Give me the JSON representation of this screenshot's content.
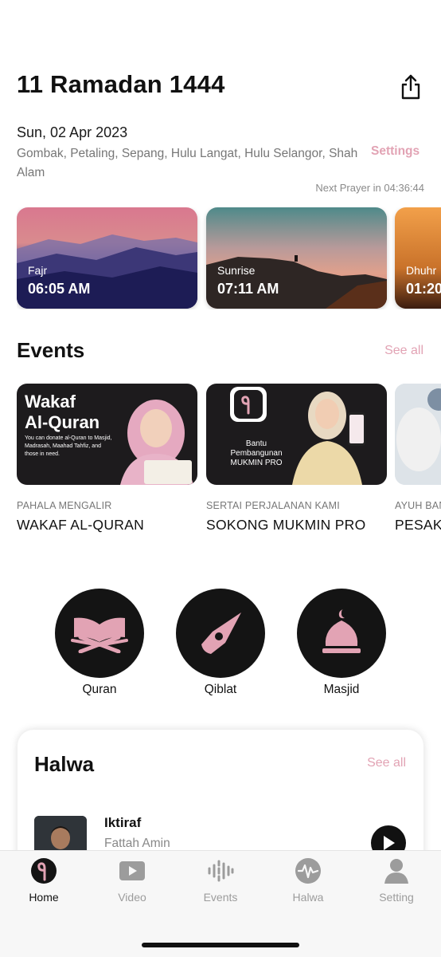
{
  "header": {
    "hijri_date": "11 Ramadan 1444",
    "share_icon": "share-icon",
    "gregorian_date": "Sun, 02 Apr 2023",
    "location": "Gombak, Petaling, Sepang, Hulu Langat, Hulu Selangor, Shah Alam",
    "settings_label": "Settings",
    "next_prayer": "Next Prayer in 04:36:44"
  },
  "prayers": [
    {
      "name": "Fajr",
      "time": "06:05 AM"
    },
    {
      "name": "Sunrise",
      "time": "07:11 AM"
    },
    {
      "name": "Dhuhr",
      "time": "01:20"
    }
  ],
  "events": {
    "title": "Events",
    "see_all": "See all",
    "items": [
      {
        "kicker": "PAHALA MENGALIR",
        "title": "WAKAF AL-QURAN",
        "banner_heading": "Wakaf Al-Quran",
        "banner_text": "You can donate al-Quran to Masjid, Madrasah, Maahad Tahfiz, and those in need."
      },
      {
        "kicker": "SERTAI PERJALANAN KAMI",
        "title": "SOKONG MUKMIN PRO",
        "banner_text": "Bantu Pembangunan MUKMIN PRO"
      },
      {
        "kicker": "AYUH BAN",
        "title": "PESAKIT"
      }
    ]
  },
  "features": [
    {
      "label": "Quran",
      "icon": "quran-book-icon"
    },
    {
      "label": "Qiblat",
      "icon": "compass-icon"
    },
    {
      "label": "Masjid",
      "icon": "mosque-dome-icon"
    }
  ],
  "halwa": {
    "title": "Halwa",
    "see_all": "See all",
    "track": {
      "title": "Iktiraf",
      "artist": "Fattah Amin"
    }
  },
  "tabbar": {
    "active": "Home",
    "items": [
      {
        "label": "Home",
        "icon": "home-logo-icon"
      },
      {
        "label": "Video",
        "icon": "video-play-icon"
      },
      {
        "label": "Events",
        "icon": "audio-wave-icon"
      },
      {
        "label": "Halwa",
        "icon": "waveform-circle-icon"
      },
      {
        "label": "Setting",
        "icon": "person-icon"
      }
    ]
  },
  "colors": {
    "accent_pink": "#e2a3b4",
    "dark": "#141414"
  }
}
